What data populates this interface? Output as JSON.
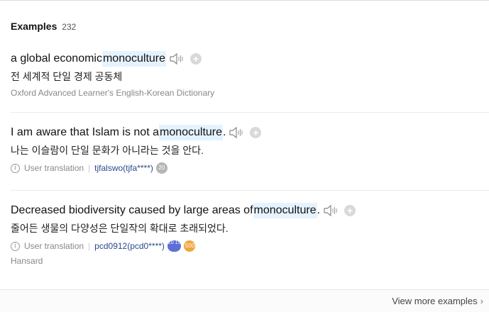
{
  "section": {
    "title": "Examples",
    "count": "232"
  },
  "examples": [
    {
      "before": "a global economic ",
      "highlight": "monoculture",
      "after": "",
      "translation": "전 세계적 단일 경제 공동체",
      "source": "Oxford Advanced Learner's English-Korean Dictionary"
    },
    {
      "before": "I am aware that Islam is not a ",
      "highlight": "monoculture",
      "after": ".",
      "translation": "나는 이슬람이 단일 문화가 아니라는 것을 안다.",
      "source_label": "User translation",
      "user": "tjfalswo(tjfa****)",
      "badges": [
        "20"
      ]
    },
    {
      "before": "Decreased biodiversity caused by large areas of ",
      "highlight": "monoculture",
      "after": ".",
      "translation": "줄어든 생물의 다양성은 단일작의 확대로 초래되었다.",
      "source_label": "User translation",
      "user": "pcd0912(pcd0****)",
      "badges": [
        "20 15",
        "500"
      ],
      "source2": "Hansard"
    }
  ],
  "footer": {
    "more_label": "View more examples",
    "chevron": "›"
  },
  "icons": {
    "speaker": "speaker-icon",
    "plus": "plus-icon",
    "info": "info-icon"
  },
  "colors": {
    "highlight": "#e5f3ff",
    "user_link": "#2a4a8c",
    "badge_blue": "#5d6fd6",
    "badge_orange": "#f0a63a"
  }
}
